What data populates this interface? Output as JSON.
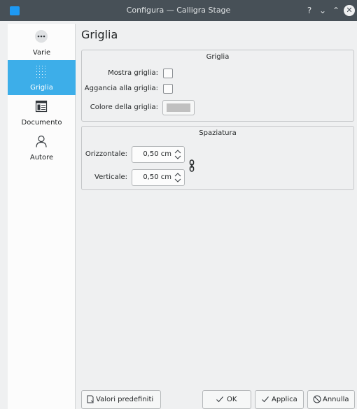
{
  "window": {
    "title": "Configura — Calligra Stage",
    "help_glyph": "?",
    "minimize_glyph": "⌄",
    "maximize_glyph": "⌃",
    "close_glyph": "✕"
  },
  "sidebar": {
    "items": [
      {
        "label": "Varie",
        "icon": "more-dots-icon",
        "active": false
      },
      {
        "label": "Griglia",
        "icon": "grid-icon",
        "active": true
      },
      {
        "label": "Documento",
        "icon": "document-icon",
        "active": false
      },
      {
        "label": "Autore",
        "icon": "user-icon",
        "active": false
      }
    ]
  },
  "page": {
    "title": "Griglia"
  },
  "grid_group": {
    "title": "Griglia",
    "show_grid_label": "Mostra griglia:",
    "show_grid_checked": false,
    "snap_grid_label": "Aggancia alla griglia:",
    "snap_grid_checked": false,
    "color_label": "Colore della griglia:",
    "color_value": "#c0c0c0"
  },
  "spacing_group": {
    "title": "Spaziatura",
    "horizontal_label": "Orizzontale:",
    "horizontal_value": "0,50 cm",
    "vertical_label": "Verticale:",
    "vertical_value": "0,50 cm"
  },
  "buttons": {
    "defaults": "Valori predefiniti",
    "ok": "OK",
    "apply": "Applica",
    "cancel": "Annulla"
  },
  "colors": {
    "titlebar": "#475057",
    "accent": "#3daee9",
    "window_bg": "#eff0f1"
  }
}
